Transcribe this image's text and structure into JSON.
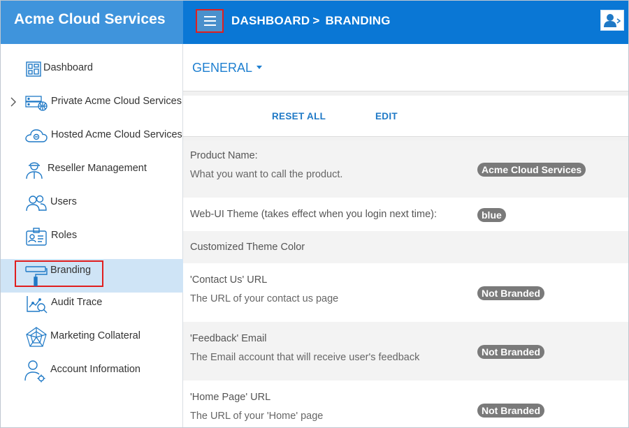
{
  "app": {
    "title": "Acme Cloud Services"
  },
  "header": {
    "breadcrumb": [
      "DASHBOARD",
      "BRANDING"
    ],
    "breadcrumb_sep": ">",
    "menu_icon": "hamburger-menu-icon",
    "user_icon": "user-account-icon"
  },
  "sidebar": {
    "items": [
      {
        "label": "Dashboard",
        "icon": "dashboard-grid-icon"
      },
      {
        "label": "Private Acme Cloud Services",
        "icon": "private-cloud-server-icon",
        "expandable": true
      },
      {
        "label": "Hosted Acme Cloud Services",
        "icon": "hosted-cloud-icon"
      },
      {
        "label": "Reseller Management",
        "icon": "reseller-person-icon"
      },
      {
        "label": "Users",
        "icon": "users-icon"
      },
      {
        "label": "Roles",
        "icon": "id-badge-icon"
      },
      {
        "label": "Branding",
        "icon": "paint-roller-icon",
        "active": true
      },
      {
        "label": "Audit Trace",
        "icon": "audit-chart-icon"
      },
      {
        "label": "Marketing Collateral",
        "icon": "spider-web-icon"
      },
      {
        "label": "Account Information",
        "icon": "account-gear-icon"
      }
    ]
  },
  "main": {
    "section_dropdown": "GENERAL",
    "actions": {
      "reset_all": "RESET ALL",
      "edit": "EDIT"
    },
    "rows": [
      {
        "title": "Product Name:",
        "description": "What you want to call the product.",
        "value": "Acme Cloud Services"
      },
      {
        "title": "Web-UI Theme (takes effect when you login next time):",
        "description": "",
        "value": "blue"
      },
      {
        "title": "Customized Theme Color",
        "description": "",
        "value": ""
      },
      {
        "title": "'Contact Us' URL",
        "description": "The URL of your contact us page",
        "value": "Not Branded"
      },
      {
        "title": "'Feedback' Email",
        "description": "The Email account that will receive user's feedback",
        "value": "Not Branded"
      },
      {
        "title": "'Home Page' URL",
        "description": "The URL of your 'Home' page",
        "value": "Not Branded"
      }
    ]
  },
  "colors": {
    "brand_bg": "#3f94dc",
    "topbar_bg": "#0a77d5",
    "active_item_bg": "#cfe4f6",
    "link_blue": "#1f79c6",
    "badge_gray": "#7a7a7a",
    "highlight_red": "#e01e1e"
  }
}
